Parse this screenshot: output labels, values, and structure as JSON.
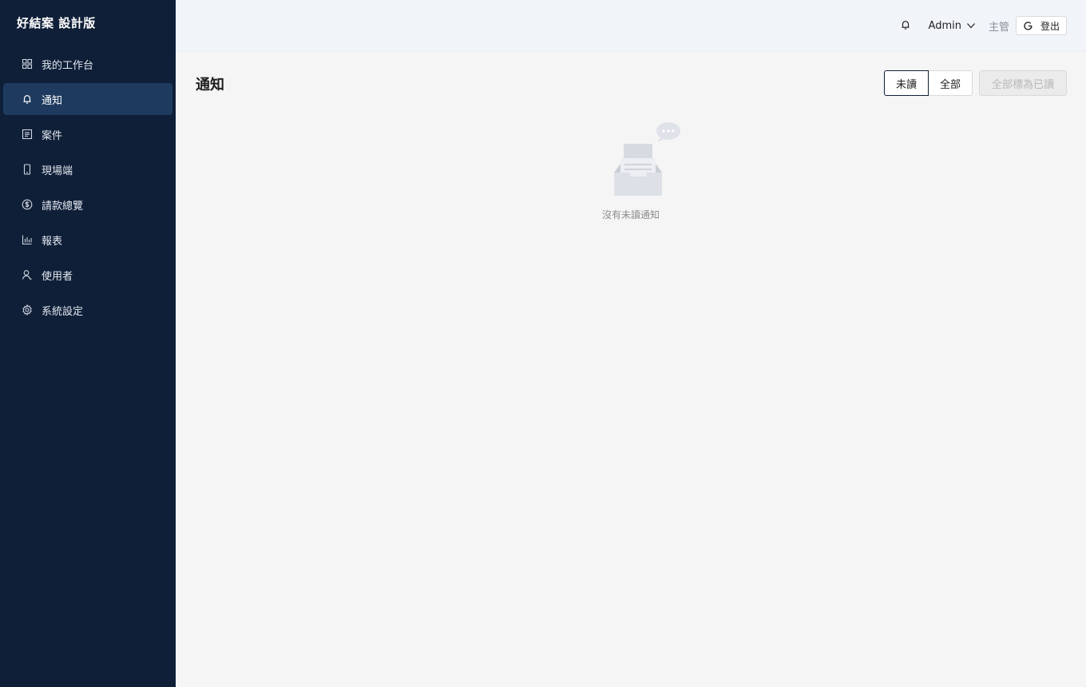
{
  "sidebar": {
    "brand": "好結案 設計版",
    "items": [
      {
        "label": "我的工作台",
        "icon": "grid-icon",
        "active": false
      },
      {
        "label": "通知",
        "icon": "bell-icon",
        "active": true
      },
      {
        "label": "案件",
        "icon": "file-list-icon",
        "active": false
      },
      {
        "label": "現場端",
        "icon": "mobile-icon",
        "active": false
      },
      {
        "label": "請款總覽",
        "icon": "dollar-circle-icon",
        "active": false
      },
      {
        "label": "報表",
        "icon": "bar-chart-icon",
        "active": false
      },
      {
        "label": "使用者",
        "icon": "user-icon",
        "active": false
      },
      {
        "label": "系統設定",
        "icon": "gear-icon",
        "active": false
      }
    ]
  },
  "header": {
    "user_name": "Admin",
    "role": "主管",
    "logout_label": "登出"
  },
  "main": {
    "title": "通知",
    "filters": [
      {
        "label": "未讀",
        "selected": true
      },
      {
        "label": "全部",
        "selected": false
      }
    ],
    "mark_all_label": "全部標為已讀",
    "empty_text": "沒有未讀通知"
  },
  "colors": {
    "sidebar_bg": "#0f1f38",
    "sidebar_active": "#1e3a5f",
    "header_bg": "#f1f4f9",
    "content_bg": "#f5f5f5"
  }
}
